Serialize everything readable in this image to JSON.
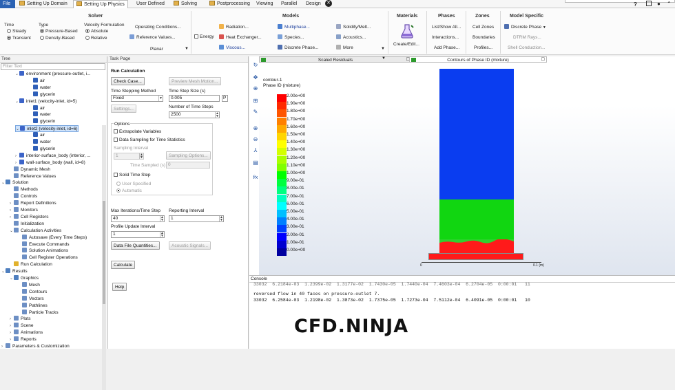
{
  "tabs": [
    "File",
    "Setting Up Domain",
    "Setting Up Physics",
    "User Defined",
    "Solving",
    "Postprocessing",
    "Viewing",
    "Parallel",
    "Design"
  ],
  "ribbon": {
    "solver": {
      "title": "Solver",
      "time_label": "Time",
      "steady": "Steady",
      "transient": "Transient",
      "type_label": "Type",
      "pressure": "Pressure-Based",
      "density": "Density-Based",
      "velocity_label": "Velocity Formulation",
      "absolute": "Absolute",
      "relative": "Relative",
      "operating": "Operating Conditions...",
      "reference": "Reference Values...",
      "planar": "Planar"
    },
    "models": {
      "title": "Models",
      "energy": "Energy",
      "radiation": "Radiation...",
      "heat_exchanger": "Heat Exchanger...",
      "viscous": "Viscous...",
      "multiphase": "Multiphase...",
      "species": "Species...",
      "discrete_phase": "Discrete Phase...",
      "solidify": "Solidify/Melt...",
      "acoustics": "Acoustics...",
      "more": "More"
    },
    "materials": {
      "title": "Materials",
      "create_edit": "Create/Edit..."
    },
    "phases": {
      "title": "Phases",
      "list_show": "List/Show All...",
      "interactions": "Interactions...",
      "add_phase": "Add Phase..."
    },
    "zones": {
      "title": "Zones",
      "cell_zones": "Cell Zones",
      "boundaries": "Boundaries",
      "profiles": "Profiles..."
    },
    "model_specific": {
      "title": "Model Specific",
      "discrete_phase": "Discrete Phase",
      "dtrm": "DTRM Rays...",
      "shell": "Shell Conduction..."
    }
  },
  "tree": {
    "header": "Tree",
    "filter_placeholder": "Filter Text",
    "items": [
      "environment (pressure-outlet, i...",
      "air",
      "water",
      "glycerin",
      "inlet1 (velocity-inlet, id=5)",
      "air",
      "water",
      "glycerin",
      "inlet2 (velocity-inlet, id=6)",
      "air",
      "water",
      "glycerin",
      "interior-surface_body (interior, ...",
      "wall-surface_body (wall, id=8)",
      "Dynamic Mesh",
      "Reference Values",
      "Solution",
      "Methods",
      "Controls",
      "Report Definitions",
      "Monitors",
      "Cell Registers",
      "Initialization",
      "Calculation Activities",
      "Autosave (Every Time Steps)",
      "Execute Commands",
      "Solution Animations",
      "Cell Register Operations",
      "Run Calculation",
      "Results",
      "Graphics",
      "Mesh",
      "Contours",
      "Vectors",
      "Pathlines",
      "Particle Tracks",
      "Plots",
      "Scene",
      "Animations",
      "Reports",
      "Parameters & Customization"
    ]
  },
  "task": {
    "header": "Task Page",
    "title": "Run Calculation",
    "check_case": "Check Case...",
    "preview_mesh": "Preview Mesh Motion...",
    "time_stepping_label": "Time Stepping Method",
    "time_stepping_value": "Fixed",
    "time_step_size_label": "Time Step Size (s)",
    "time_step_size_value": "0.005",
    "param_flag": "P",
    "settings": "Settings...",
    "num_steps_label": "Number of Time Steps",
    "num_steps_value": "2500",
    "options_label": "Options",
    "extrapolate": "Extrapolate Variables",
    "data_sampling": "Data Sampling for Time Statistics",
    "sampling_interval_label": "Sampling Interval",
    "sampling_interval_value": "1",
    "sampling_options": "Sampling Options...",
    "time_sampled_label": "Time Sampled (s)",
    "time_sampled_value": "0",
    "solid_time_step": "Solid Time Step",
    "user_specified": "User Specified",
    "automatic": "Automatic",
    "max_iter_label": "Max Iterations/Time Step",
    "max_iter_value": "40",
    "reporting_label": "Reporting Interval",
    "reporting_value": "1",
    "profile_label": "Profile Update Interval",
    "profile_value": "1",
    "data_file": "Data File Quantities...",
    "acoustic": "Acoustic Signals...",
    "calculate": "Calculate",
    "help": "Help"
  },
  "graphics": {
    "tab1": "Scaled Residuals",
    "tab2": "Contours of Phase ID (mixture)",
    "contour_name": "contour-1",
    "contour_var": "Phase ID (mixture)",
    "legend": [
      "2.00e+00",
      "1.90e+00",
      "1.80e+00",
      "1.70e+00",
      "1.60e+00",
      "1.50e+00",
      "1.40e+00",
      "1.30e+00",
      "1.20e+00",
      "1.10e+00",
      "1.00e+00",
      "9.00e-01",
      "8.00e-01",
      "7.00e-01",
      "6.00e-01",
      "5.00e-01",
      "4.00e-01",
      "3.00e-01",
      "2.00e-01",
      "1.00e-01",
      "0.00e+00"
    ],
    "legend_colors": [
      "#ff0000",
      "#ff2a00",
      "#ff5500",
      "#ff8000",
      "#ffaa00",
      "#ffd500",
      "#ffff00",
      "#d4ff00",
      "#aaff00",
      "#80ff00",
      "#00ff00",
      "#00ff40",
      "#00ff80",
      "#00ffbf",
      "#00ffff",
      "#00bfff",
      "#0080ff",
      "#0040ff",
      "#0000ff",
      "#0000d0",
      "#0000a0"
    ],
    "axis_min": "0",
    "axis_max": "0.1 (m)",
    "phase_top_color": "#0a3df0",
    "phase_mid_color": "#11d611",
    "phase_bottom_color": "#ff1a1a"
  },
  "console": {
    "header": "Console",
    "line1": "33032  6.2184e-03  1.2399e-02  1.3177e-02  1.7430e-05  1.7440e-04  7.4603e-04  6.2704e-05  0:00:01   11",
    "line2": "reversed flow in 40 faces on pressure-outlet 7.",
    "line3": "33032  6.2584e-03  1.2198e-02  1.3873e-02  1.7375e-05  1.7273e-04  7.5112e-04  6.4091e-05  0:00:01   10",
    "watermark": "CFD.NINJA"
  }
}
